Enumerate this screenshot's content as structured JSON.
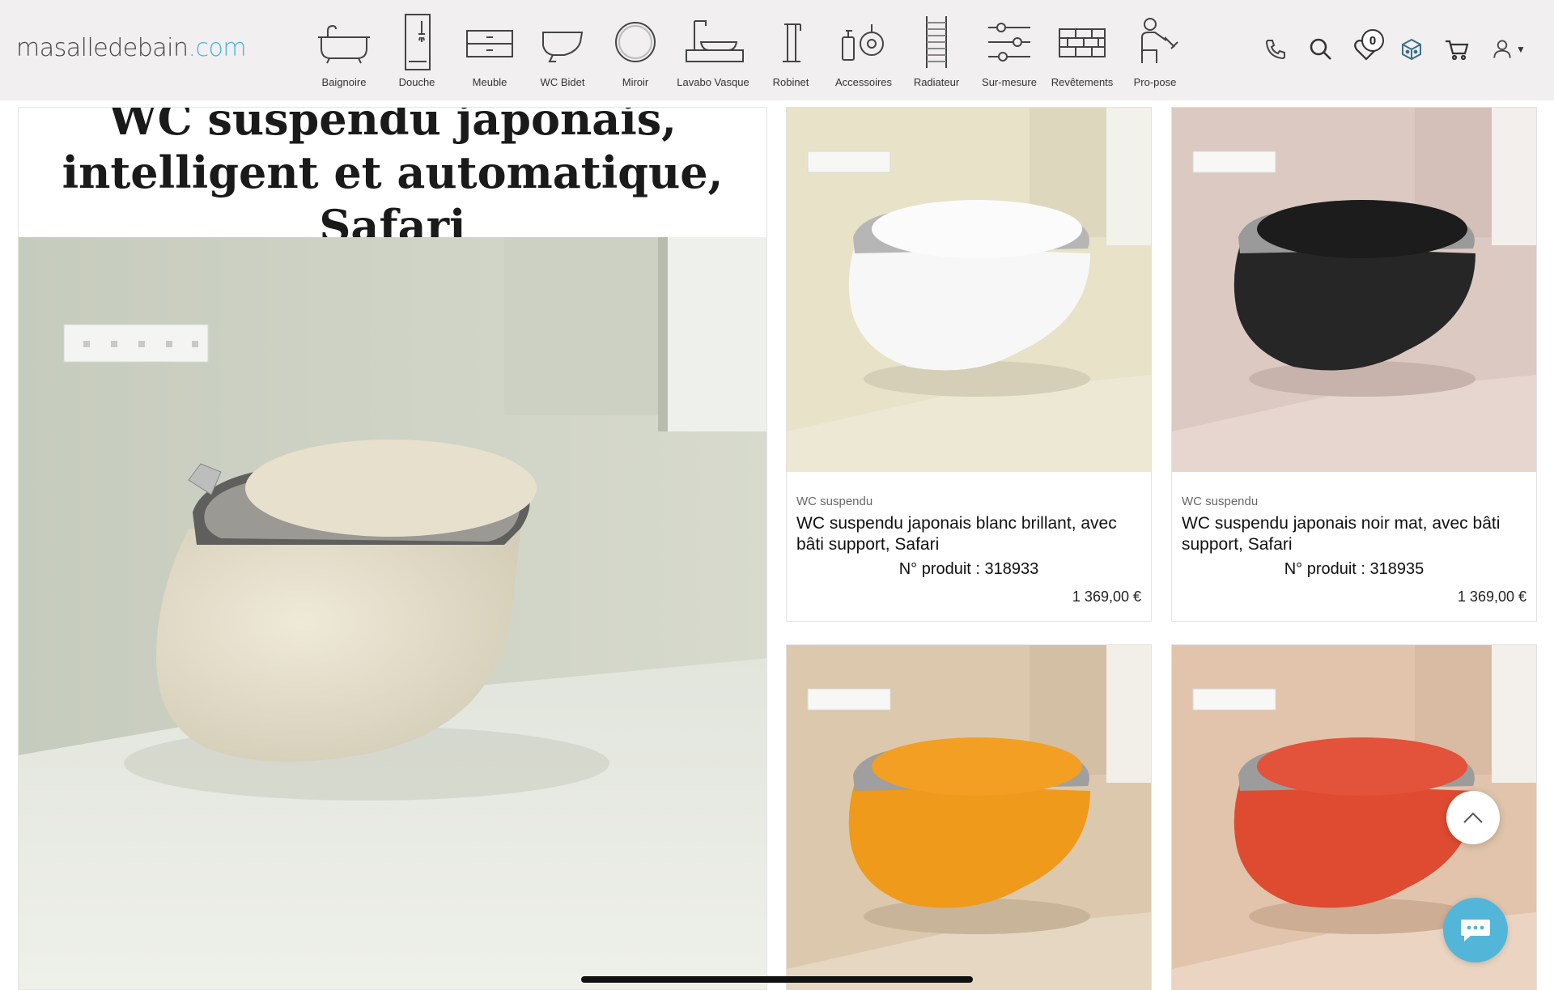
{
  "header": {
    "logo": {
      "name": "masalledebain",
      "tld": ".com"
    },
    "nav": [
      {
        "label": "Baignoire",
        "icon": "bathtub-icon"
      },
      {
        "label": "Douche",
        "icon": "shower-icon"
      },
      {
        "label": "Meuble",
        "icon": "cabinet-icon"
      },
      {
        "label": "WC Bidet",
        "icon": "toilet-icon"
      },
      {
        "label": "Miroir",
        "icon": "mirror-icon"
      },
      {
        "label": "Lavabo Vasque",
        "icon": "sink-icon"
      },
      {
        "label": "Robinet",
        "icon": "faucet-icon"
      },
      {
        "label": "Accessoires",
        "icon": "accessories-icon"
      },
      {
        "label": "Radiateur",
        "icon": "radiator-icon"
      },
      {
        "label": "Sur-mesure",
        "icon": "sliders-icon"
      },
      {
        "label": "Revêtements",
        "icon": "bricks-icon"
      },
      {
        "label": "Pro-pose",
        "icon": "installer-icon"
      }
    ],
    "tools": {
      "wishlist_count": "0"
    }
  },
  "hero": {
    "title": "WC suspendu japonais, intelligent et automatique, Safari",
    "color": "#e9e4d4"
  },
  "products": [
    {
      "category": "WC suspendu",
      "name": "WC suspendu japonais blanc brillant, avec bâti support, Safari",
      "pno_label": "N° produit :",
      "pno": "318933",
      "price": "1 369,00 €",
      "color": "#ffffff",
      "wall": "#e7e2c8"
    },
    {
      "category": "WC suspendu",
      "name": "WC suspendu japonais noir mat, avec bâti support, Safari",
      "pno_label": "N° produit :",
      "pno": "318935",
      "price": "1 369,00 €",
      "color": "#1e1e1e",
      "wall": "#dcc9c1"
    },
    {
      "color": "#f09a17",
      "wall": "#dcc8ad"
    },
    {
      "color": "#e04e33",
      "wall": "#e1c4ab"
    }
  ],
  "colors": {
    "accent": "#4ab4d6",
    "chat": "#53b6d8"
  }
}
